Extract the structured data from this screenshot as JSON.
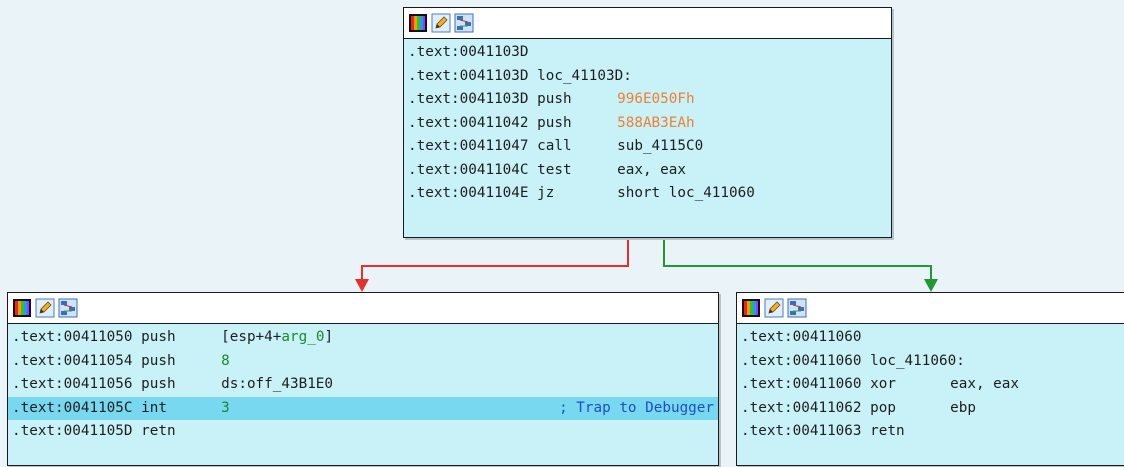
{
  "header_icons": [
    "color-palette-icon",
    "edit-pencil-icon",
    "graph-view-icon"
  ],
  "colors": {
    "edge_false": "#e8302a",
    "edge_true": "#1f9a32",
    "node_bg": "#c8f2f8",
    "highlight": "#78d8f0"
  },
  "nodes": {
    "top": {
      "lines": [
        {
          "addr": ".text:0041103D",
          "mn": "",
          "op": ""
        },
        {
          "addr": ".text:0041103D",
          "label": "loc_41103D:"
        },
        {
          "addr": ".text:0041103D",
          "mn": "push",
          "op": "996E050Fh"
        },
        {
          "addr": ".text:00411042",
          "mn": "push",
          "op": "588AB3EAh"
        },
        {
          "addr": ".text:00411047",
          "mn": "call",
          "op": "sub_4115C0"
        },
        {
          "addr": ".text:0041104C",
          "mn": "test",
          "op": "eax, eax"
        },
        {
          "addr": ".text:0041104E",
          "mn": "jz",
          "op": "short loc_411060"
        }
      ]
    },
    "left": {
      "lines": [
        {
          "addr": ".text:00411050",
          "mn": "push",
          "op_pre": "[esp+4+",
          "op_arg": "arg_0",
          "op_post": "]"
        },
        {
          "addr": ".text:00411054",
          "mn": "push",
          "op": "8"
        },
        {
          "addr": ".text:00411056",
          "mn": "push",
          "op": "ds:off_43B1E0"
        },
        {
          "addr": ".text:0041105C",
          "mn": "int",
          "op": "3",
          "comment": "; Trap to Debugger"
        },
        {
          "addr": ".text:0041105D",
          "mn": "retn",
          "op": ""
        }
      ]
    },
    "right": {
      "lines": [
        {
          "addr": ".text:00411060",
          "mn": "",
          "op": ""
        },
        {
          "addr": ".text:00411060",
          "label": "loc_411060:"
        },
        {
          "addr": ".text:00411060",
          "mn": "xor",
          "op": "eax, eax"
        },
        {
          "addr": ".text:00411062",
          "mn": "pop",
          "op": "ebp"
        },
        {
          "addr": ".text:00411063",
          "mn": "retn",
          "op": ""
        }
      ]
    }
  }
}
